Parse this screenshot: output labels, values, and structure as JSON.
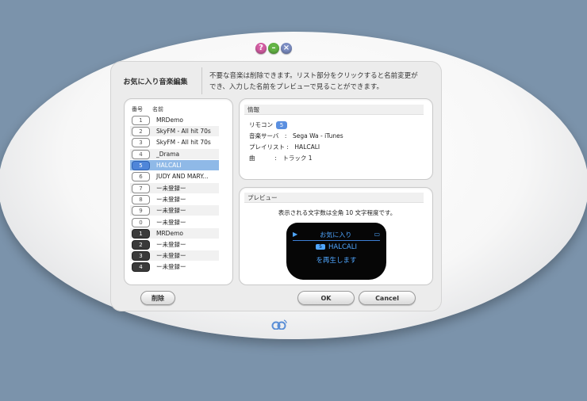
{
  "header": {
    "title": "お気に入り音楽編集",
    "description_line1": "不要な音楽は削除できます。リスト部分をクリックすると名前変更が",
    "description_line2": "でき、入力した名前をプレビューで見ることができます。"
  },
  "list": {
    "col_number": "番号",
    "col_name": "名前",
    "rows": [
      {
        "num": "1",
        "name": "MRDemo",
        "style": "normal"
      },
      {
        "num": "2",
        "name": "SkyFM - All hit 70s",
        "style": "normal"
      },
      {
        "num": "3",
        "name": "SkyFM - All hit 70s",
        "style": "normal"
      },
      {
        "num": "4",
        "name": "_Drama",
        "style": "normal"
      },
      {
        "num": "5",
        "name": "HALCALI",
        "style": "selected"
      },
      {
        "num": "6",
        "name": "JUDY AND MARY...",
        "style": "normal"
      },
      {
        "num": "7",
        "name": "ー未登録ー",
        "style": "normal"
      },
      {
        "num": "8",
        "name": "ー未登録ー",
        "style": "normal"
      },
      {
        "num": "9",
        "name": "ー未登録ー",
        "style": "normal"
      },
      {
        "num": "0",
        "name": "ー未登録ー",
        "style": "normal"
      },
      {
        "num": "1",
        "name": "MRDemo",
        "style": "dark"
      },
      {
        "num": "2",
        "name": "ー未登録ー",
        "style": "dark"
      },
      {
        "num": "3",
        "name": "ー未登録ー",
        "style": "dark"
      },
      {
        "num": "4",
        "name": "ー未登録ー",
        "style": "dark"
      }
    ]
  },
  "info": {
    "title": "情報",
    "remocon_label": "リモコン",
    "remocon_value": "5",
    "server_label": "音楽サーバ",
    "server_value": "Sega Wa - iTunes",
    "playlist_label": "プレイリスト",
    "playlist_value": "HALCALI",
    "song_label": "曲",
    "song_value": "トラック 1"
  },
  "preview": {
    "title": "プレビュー",
    "caption": "表示される文字数は全角 10 文字程度です。",
    "lcd_line1": "お気に入り",
    "lcd_line2": "HALCALI",
    "lcd_line2_badge": "5",
    "lcd_line3": "を再生します"
  },
  "buttons": {
    "delete": "削除",
    "ok": "OK",
    "cancel": "Cancel"
  },
  "window_controls": {
    "help": "?",
    "minimize": "–",
    "close": "×"
  },
  "icons": [
    "help-icon",
    "minimize-icon",
    "close-icon",
    "play-icon",
    "battery-icon",
    "logo-icon"
  ]
}
